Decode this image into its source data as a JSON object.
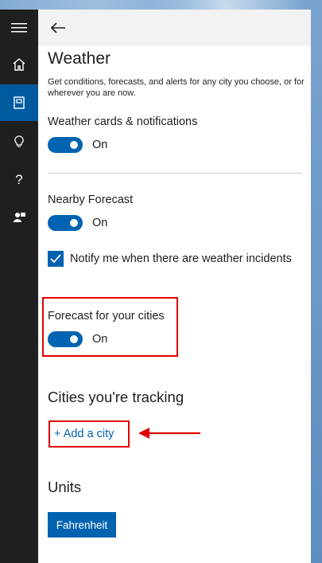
{
  "colors": {
    "accent": "#0063b1",
    "rail": "#1f1f1f",
    "annotation": "#e00000"
  },
  "rail": {
    "items": [
      {
        "icon": "hamburger-menu-icon"
      },
      {
        "icon": "home-icon"
      },
      {
        "icon": "notebook-icon",
        "active": true
      },
      {
        "icon": "lightbulb-icon"
      },
      {
        "icon": "help-icon",
        "glyph": "?"
      },
      {
        "icon": "feedback-icon"
      }
    ]
  },
  "header": {
    "back_icon": "back-arrow-icon"
  },
  "page": {
    "title": "Weather",
    "description": "Get conditions, forecasts, and alerts for any city you choose, or for wherever you are now."
  },
  "settings": {
    "weather_cards": {
      "label": "Weather cards & notifications",
      "state": "On"
    },
    "nearby_forecast": {
      "label": "Nearby Forecast",
      "state": "On"
    },
    "notify_incidents": {
      "label": "Notify me when there are weather incidents",
      "checked": true
    },
    "forecast_cities": {
      "label": "Forecast for your cities",
      "state": "On"
    }
  },
  "cities": {
    "heading": "Cities you're tracking",
    "add_label": "+ Add a city"
  },
  "units": {
    "heading": "Units",
    "button_label": "Fahrenheit"
  }
}
